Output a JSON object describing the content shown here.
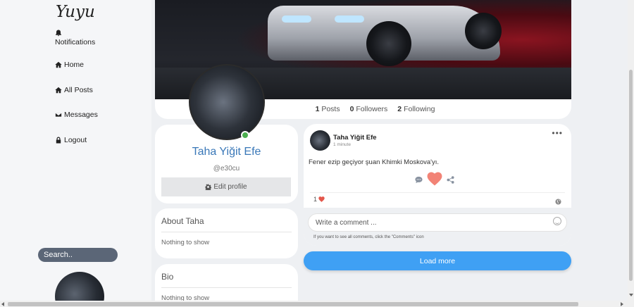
{
  "sidebar": {
    "brand": "Yuyu",
    "nav": {
      "notifications": "Notifications",
      "home": "Home",
      "all_posts": "All Posts",
      "messages": "Messages",
      "logout": "Logout"
    },
    "search_placeholder": "Search.."
  },
  "profile": {
    "stats": {
      "posts_count": "1",
      "posts_label": "Posts",
      "followers_count": "0",
      "followers_label": "Followers",
      "following_count": "2",
      "following_label": "Following"
    },
    "name": "Taha Yiğit Efe",
    "handle": "@e30cu",
    "edit_label": "Edit profile",
    "online_color": "#4caf50"
  },
  "about": {
    "title": "About Taha",
    "body": "Nothing to show"
  },
  "bio": {
    "title": "Bio",
    "body": "Nothing to show"
  },
  "post": {
    "author": "Taha Yiğit Efe",
    "time": "1 minute",
    "text": "Fener ezip geçiyor şuan Khimki Moskova'yı.",
    "like_count": "1",
    "comment_placeholder": "Write a comment ...",
    "hint": "If you want to see all comments, click the \"Comments\" icon",
    "heart_color": "#f28376"
  },
  "load_more": "Load more",
  "accent_color": "#3fa0f4"
}
